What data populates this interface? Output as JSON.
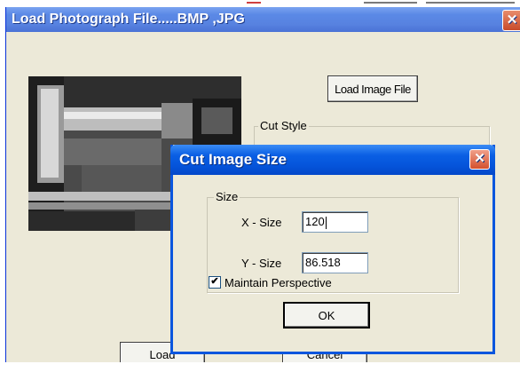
{
  "main_window": {
    "title": "Load Photograph File.....BMP ,JPG",
    "close_glyph": "✕",
    "load_image_button": "Load Image File",
    "cut_style_label": "Cut Style",
    "load_button": "Load",
    "cancel_button": "Cancel"
  },
  "dialog": {
    "title": "Cut Image Size",
    "close_glyph": "✕",
    "size_group_label": "Size",
    "x_size_label": "X - Size",
    "x_size_value": "120",
    "y_size_label": "Y - Size",
    "y_size_value": "86.518",
    "maintain_perspective_label": "Maintain Perspective",
    "maintain_perspective_checked": "✔",
    "ok_button": "OK"
  },
  "icons": {
    "window_close": "close-icon",
    "dialog_close": "close-icon",
    "checkbox_mark": "check-icon"
  },
  "colors": {
    "xp_title_blue": "#0a5fe4",
    "dialog_face": "#ece9d8",
    "close_red": "#d4502e"
  }
}
